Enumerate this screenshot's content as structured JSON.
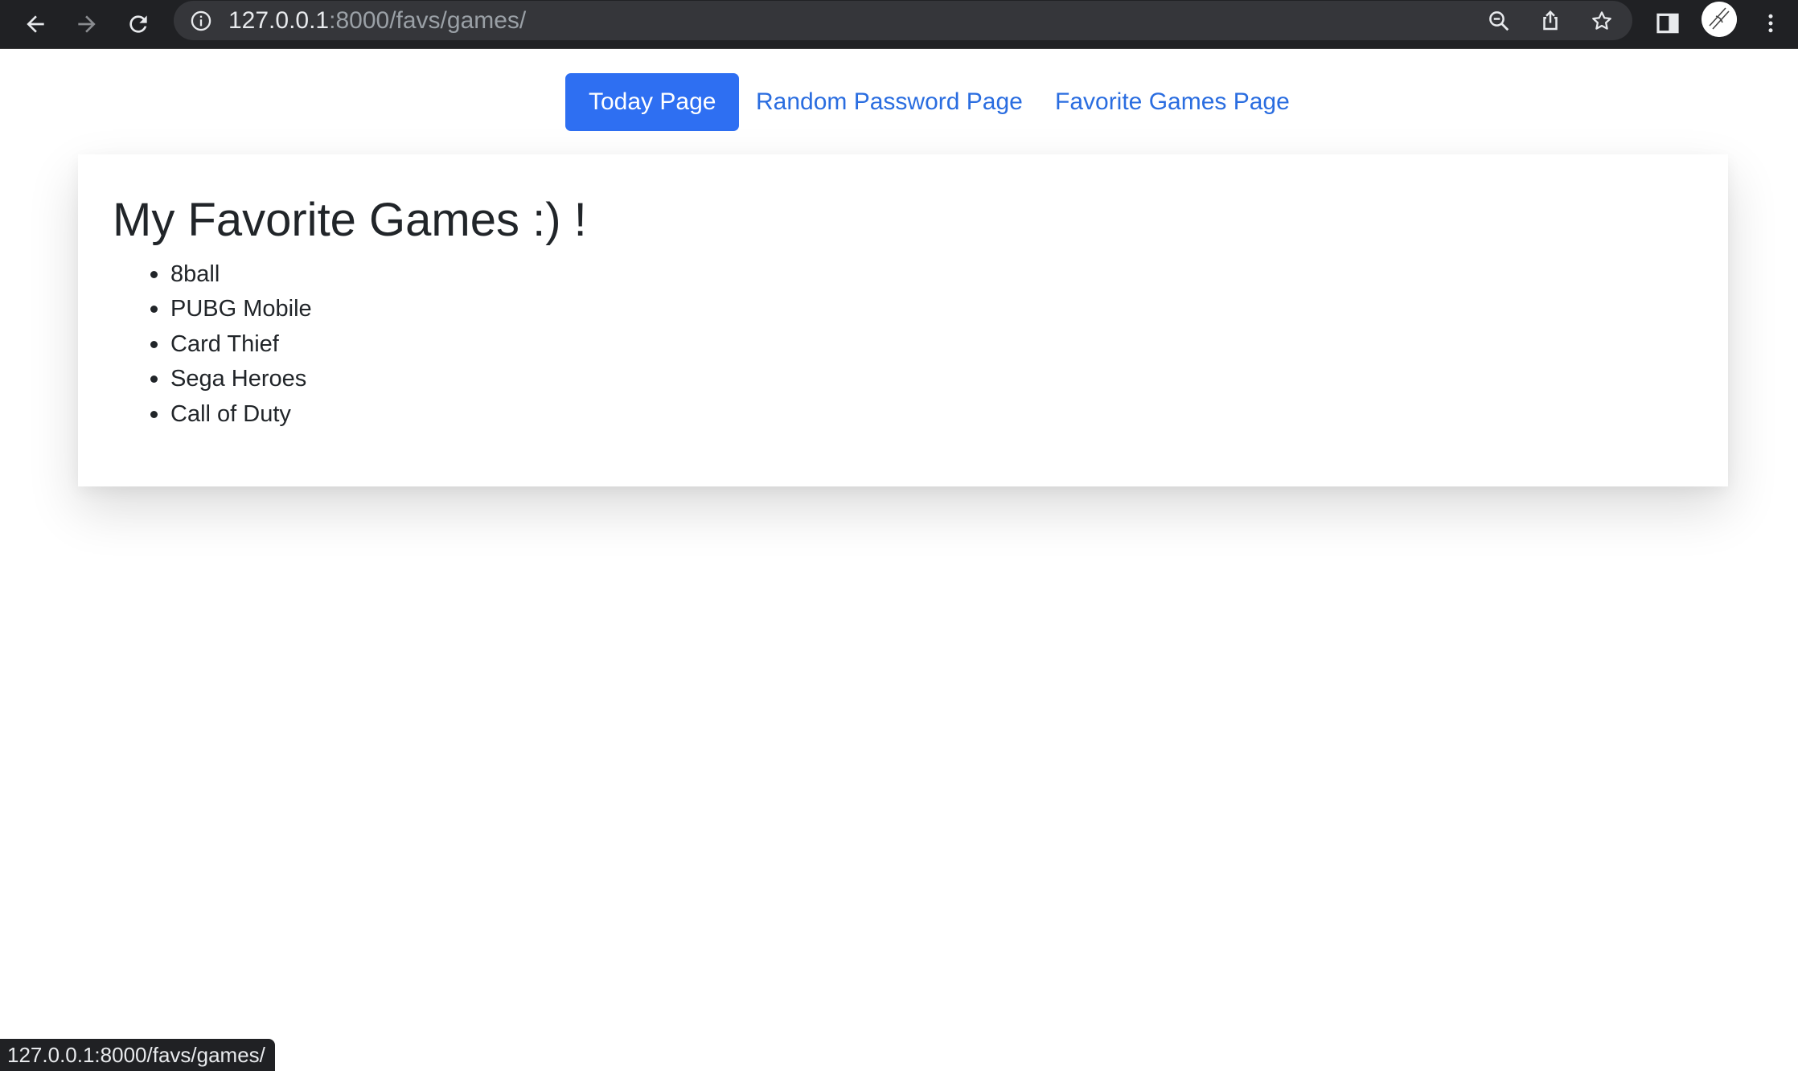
{
  "browser": {
    "url_host": "127.0.0.1",
    "url_rest": ":8000/favs/games/"
  },
  "nav": {
    "links": [
      {
        "label": "Today Page"
      },
      {
        "label": "Random Password Page"
      },
      {
        "label": "Favorite Games Page"
      }
    ]
  },
  "main": {
    "title": "My Favorite Games :) !",
    "games": [
      "8ball",
      "PUBG Mobile",
      "Card Thief",
      "Sega Heroes",
      "Call of Duty"
    ]
  },
  "status_bar": {
    "url": "127.0.0.1:8000/favs/games/"
  },
  "colors": {
    "accent": "#2e6ff2",
    "link": "#2a6de0",
    "chrome_dark": "#202124"
  },
  "icons": [
    "back-arrow-icon",
    "forward-arrow-icon",
    "reload-icon",
    "info-icon",
    "zoom-icon",
    "share-icon",
    "star-icon",
    "side-panel-icon",
    "avatar",
    "kebab-menu-icon"
  ]
}
